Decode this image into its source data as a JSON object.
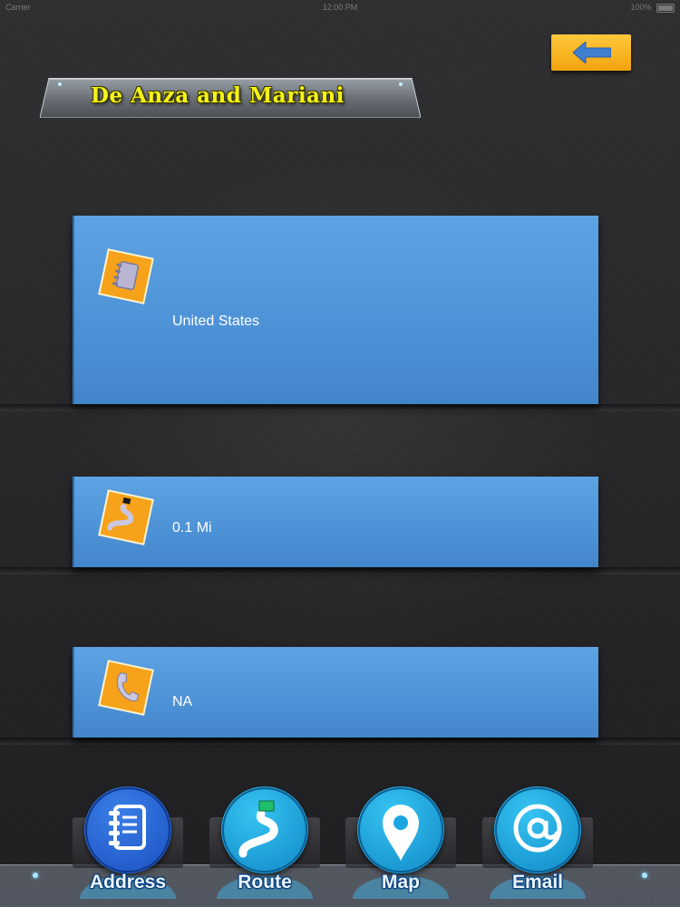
{
  "status_bar": {
    "carrier": "Carrier",
    "time": "12:00 PM",
    "battery": "100%"
  },
  "header": {
    "title": "De Anza and Mariani",
    "back_icon": "back-arrow-icon"
  },
  "cards": [
    {
      "icon": "address-book-icon",
      "value": "United States"
    },
    {
      "icon": "route-icon",
      "value": "0.1 Mi"
    },
    {
      "icon": "phone-icon",
      "value": "NA"
    }
  ],
  "tabs": [
    {
      "icon": "address-book-icon",
      "label": "Address",
      "color": "#1f5fd6"
    },
    {
      "icon": "route-icon",
      "label": "Route",
      "color": "#1aa6e0"
    },
    {
      "icon": "map-pin-icon",
      "label": "Map",
      "color": "#1aa6e0"
    },
    {
      "icon": "email-at-icon",
      "label": "Email",
      "color": "#1aa6e0"
    }
  ],
  "colors": {
    "card_blue": "#4d92d6",
    "title_yellow": "#f6f11a",
    "icon_orange": "#f7a21b",
    "back_button": "#f7b525"
  }
}
